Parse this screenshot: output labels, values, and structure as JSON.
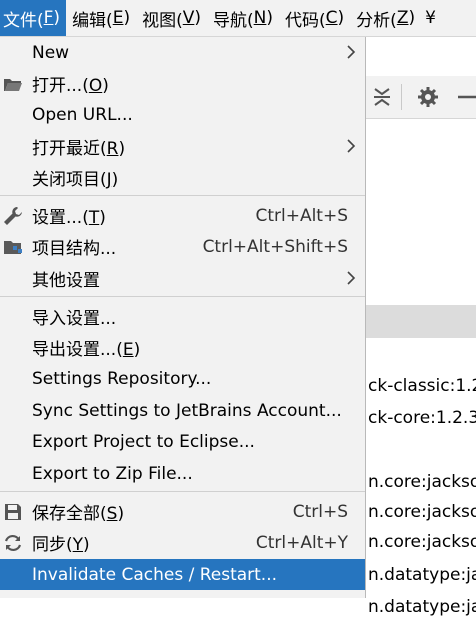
{
  "menubar": {
    "items": [
      {
        "label": "文件(",
        "mn": "F",
        "tail": ")"
      },
      {
        "label": "编辑(",
        "mn": "E",
        "tail": ")"
      },
      {
        "label": "视图(",
        "mn": "V",
        "tail": ")"
      },
      {
        "label": "导航(",
        "mn": "N",
        "tail": ")"
      },
      {
        "label": "代码(",
        "mn": "C",
        "tail": ")"
      },
      {
        "label": "分析(",
        "mn": "Z",
        "tail": ")"
      },
      {
        "label": "¥",
        "mn": "",
        "tail": ""
      }
    ]
  },
  "menu": {
    "new": "New",
    "open_a": "打开...(",
    "open_mn": "O",
    "open_b": ")",
    "open_url": "Open URL...",
    "recent_a": "打开最近(",
    "recent_mn": "R",
    "recent_b": ")",
    "close_a": "关闭项目(",
    "close_mn": "J",
    "close_b": ")",
    "settings_a": "设置...(",
    "settings_mn": "T",
    "settings_b": ")",
    "settings_sc": "Ctrl+Alt+S",
    "structure": "项目结构...",
    "structure_sc": "Ctrl+Alt+Shift+S",
    "other_settings": "其他设置",
    "import_settings": "导入设置...",
    "export_a": "导出设置...(",
    "export_mn": "E",
    "export_b": ")",
    "settings_repo": "Settings Repository...",
    "sync": "Sync Settings to JetBrains Account...",
    "export_eclipse": "Export Project to Eclipse...",
    "export_zip": "Export to Zip File...",
    "save_a": "保存全部(",
    "save_mn": "S",
    "save_b": ")",
    "save_sc": "Ctrl+S",
    "sync2_a": "同步(",
    "sync2_mn": "Y",
    "sync2_b": ")",
    "sync2_sc": "Ctrl+Alt+Y",
    "invalidate": "Invalidate Caches / Restart..."
  },
  "background": {
    "lines": [
      "ck-classic:1.2",
      "ck-core:1.2.3",
      "n.core:jackson",
      "n.core:jackson",
      "n.core:jackson",
      "n.datatype:jac",
      "n.datatype:jac"
    ]
  },
  "colors": {
    "accent": "#2675bf",
    "menu_bg": "#f2f2f2"
  }
}
